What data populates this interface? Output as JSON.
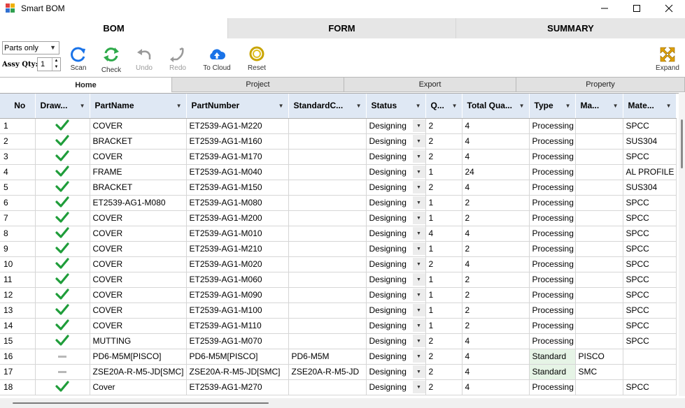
{
  "window": {
    "title": "Smart BOM"
  },
  "main_tabs": [
    {
      "label": "BOM",
      "active": true
    },
    {
      "label": "FORM",
      "active": false
    },
    {
      "label": "SUMMARY",
      "active": false
    }
  ],
  "toolbar": {
    "mode_select": "Parts only",
    "assy_qty_label": "Assy Qty:",
    "assy_qty_value": "1",
    "scan": "Scan",
    "check": "Check",
    "undo": "Undo",
    "redo": "Redo",
    "to_cloud": "To Cloud",
    "reset": "Reset",
    "expand": "Expand"
  },
  "sub_tabs": [
    {
      "label": "Home",
      "active": true
    },
    {
      "label": "Project",
      "active": false
    },
    {
      "label": "Export",
      "active": false
    },
    {
      "label": "Property",
      "active": false
    }
  ],
  "grid": {
    "columns": [
      "No",
      "Draw...",
      "PartName",
      "PartNumber",
      "StandardC...",
      "Status",
      "Q...",
      "Total Qua...",
      "Type",
      "Ma...",
      "Mate..."
    ],
    "rows": [
      {
        "no": "1",
        "drawn": "check",
        "part_name": "COVER",
        "part_number": "ET2539-AG1-M220",
        "standard_code": "",
        "status": "Designing",
        "qty": "2",
        "total_qty": "4",
        "type": "Processing",
        "maker": "",
        "material": "SPCC"
      },
      {
        "no": "2",
        "drawn": "check",
        "part_name": "BRACKET",
        "part_number": "ET2539-AG1-M160",
        "standard_code": "",
        "status": "Designing",
        "qty": "2",
        "total_qty": "4",
        "type": "Processing",
        "maker": "",
        "material": "SUS304"
      },
      {
        "no": "3",
        "drawn": "check",
        "part_name": "COVER",
        "part_number": "ET2539-AG1-M170",
        "standard_code": "",
        "status": "Designing",
        "qty": "2",
        "total_qty": "4",
        "type": "Processing",
        "maker": "",
        "material": "SPCC"
      },
      {
        "no": "4",
        "drawn": "check",
        "part_name": "FRAME",
        "part_number": "ET2539-AG1-M040",
        "standard_code": "",
        "status": "Designing",
        "qty": "1",
        "total_qty": "24",
        "type": "Processing",
        "maker": "",
        "material": "AL PROFILE"
      },
      {
        "no": "5",
        "drawn": "check",
        "part_name": "BRACKET",
        "part_number": "ET2539-AG1-M150",
        "standard_code": "",
        "status": "Designing",
        "qty": "2",
        "total_qty": "4",
        "type": "Processing",
        "maker": "",
        "material": "SUS304"
      },
      {
        "no": "6",
        "drawn": "check",
        "part_name": "ET2539-AG1-M080",
        "part_number": "ET2539-AG1-M080",
        "standard_code": "",
        "status": "Designing",
        "qty": "1",
        "total_qty": "2",
        "type": "Processing",
        "maker": "",
        "material": "SPCC"
      },
      {
        "no": "7",
        "drawn": "check",
        "part_name": "COVER",
        "part_number": "ET2539-AG1-M200",
        "standard_code": "",
        "status": "Designing",
        "qty": "1",
        "total_qty": "2",
        "type": "Processing",
        "maker": "",
        "material": "SPCC"
      },
      {
        "no": "8",
        "drawn": "check",
        "part_name": "COVER",
        "part_number": "ET2539-AG1-M010",
        "standard_code": "",
        "status": "Designing",
        "qty": "4",
        "total_qty": "4",
        "type": "Processing",
        "maker": "",
        "material": "SPCC"
      },
      {
        "no": "9",
        "drawn": "check",
        "part_name": "COVER",
        "part_number": "ET2539-AG1-M210",
        "standard_code": "",
        "status": "Designing",
        "qty": "1",
        "total_qty": "2",
        "type": "Processing",
        "maker": "",
        "material": "SPCC"
      },
      {
        "no": "10",
        "drawn": "check",
        "part_name": "COVER",
        "part_number": "ET2539-AG1-M020",
        "standard_code": "",
        "status": "Designing",
        "qty": "2",
        "total_qty": "4",
        "type": "Processing",
        "maker": "",
        "material": "SPCC"
      },
      {
        "no": "11",
        "drawn": "check",
        "part_name": "COVER",
        "part_number": "ET2539-AG1-M060",
        "standard_code": "",
        "status": "Designing",
        "qty": "1",
        "total_qty": "2",
        "type": "Processing",
        "maker": "",
        "material": "SPCC"
      },
      {
        "no": "12",
        "drawn": "check",
        "part_name": "COVER",
        "part_number": "ET2539-AG1-M090",
        "standard_code": "",
        "status": "Designing",
        "qty": "1",
        "total_qty": "2",
        "type": "Processing",
        "maker": "",
        "material": "SPCC"
      },
      {
        "no": "13",
        "drawn": "check",
        "part_name": "COVER",
        "part_number": "ET2539-AG1-M100",
        "standard_code": "",
        "status": "Designing",
        "qty": "1",
        "total_qty": "2",
        "type": "Processing",
        "maker": "",
        "material": "SPCC"
      },
      {
        "no": "14",
        "drawn": "check",
        "part_name": "COVER",
        "part_number": "ET2539-AG1-M110",
        "standard_code": "",
        "status": "Designing",
        "qty": "1",
        "total_qty": "2",
        "type": "Processing",
        "maker": "",
        "material": "SPCC"
      },
      {
        "no": "15",
        "drawn": "check",
        "part_name": "MUTTING",
        "part_number": "ET2539-AG1-M070",
        "standard_code": "",
        "status": "Designing",
        "qty": "2",
        "total_qty": "4",
        "type": "Processing",
        "maker": "",
        "material": "SPCC"
      },
      {
        "no": "16",
        "drawn": "dash",
        "part_name": "PD6-M5M[PISCO]",
        "part_number": "PD6-M5M[PISCO]",
        "standard_code": "PD6-M5M",
        "status": "Designing",
        "qty": "2",
        "total_qty": "4",
        "type": "Standard",
        "maker": "PISCO",
        "material": ""
      },
      {
        "no": "17",
        "drawn": "dash",
        "part_name": "ZSE20A-R-M5-JD[SMC]",
        "part_number": "ZSE20A-R-M5-JD[SMC]",
        "standard_code": "ZSE20A-R-M5-JD",
        "status": "Designing",
        "qty": "2",
        "total_qty": "4",
        "type": "Standard",
        "maker": "SMC",
        "material": ""
      },
      {
        "no": "18",
        "drawn": "check",
        "part_name": "Cover",
        "part_number": "ET2539-AG1-M270",
        "standard_code": "",
        "status": "Designing",
        "qty": "2",
        "total_qty": "4",
        "type": "Processing",
        "maker": "",
        "material": "SPCC"
      }
    ]
  },
  "colors": {
    "check_green": "#1f9d3a",
    "header_bg": "#dfe8f4",
    "standard_bg": "#e6f4e6",
    "cloud_blue": "#1a73e8",
    "reset_yellow": "#d4b000",
    "expand_orange": "#e0a000"
  }
}
